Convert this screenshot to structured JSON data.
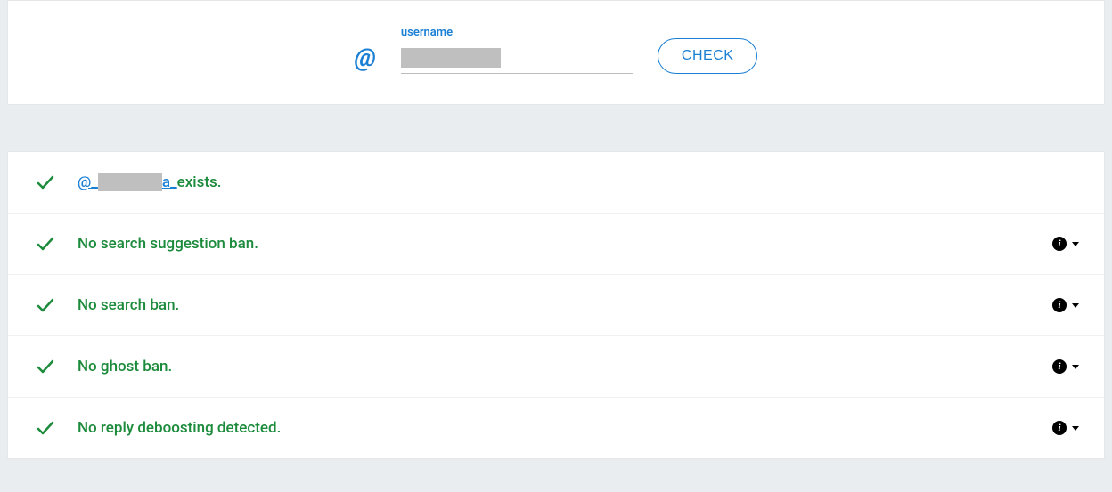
{
  "search": {
    "label": "username",
    "at": "@",
    "check_label": "CHECK"
  },
  "results": {
    "exists": {
      "prefix": "@_",
      "suffix": "a_",
      "tail": " exists."
    },
    "rows": [
      {
        "text": "No search suggestion ban."
      },
      {
        "text": "No search ban."
      },
      {
        "text": "No ghost ban."
      },
      {
        "text": "No reply deboosting detected."
      }
    ]
  },
  "icons": {
    "info_glyph": "i"
  }
}
